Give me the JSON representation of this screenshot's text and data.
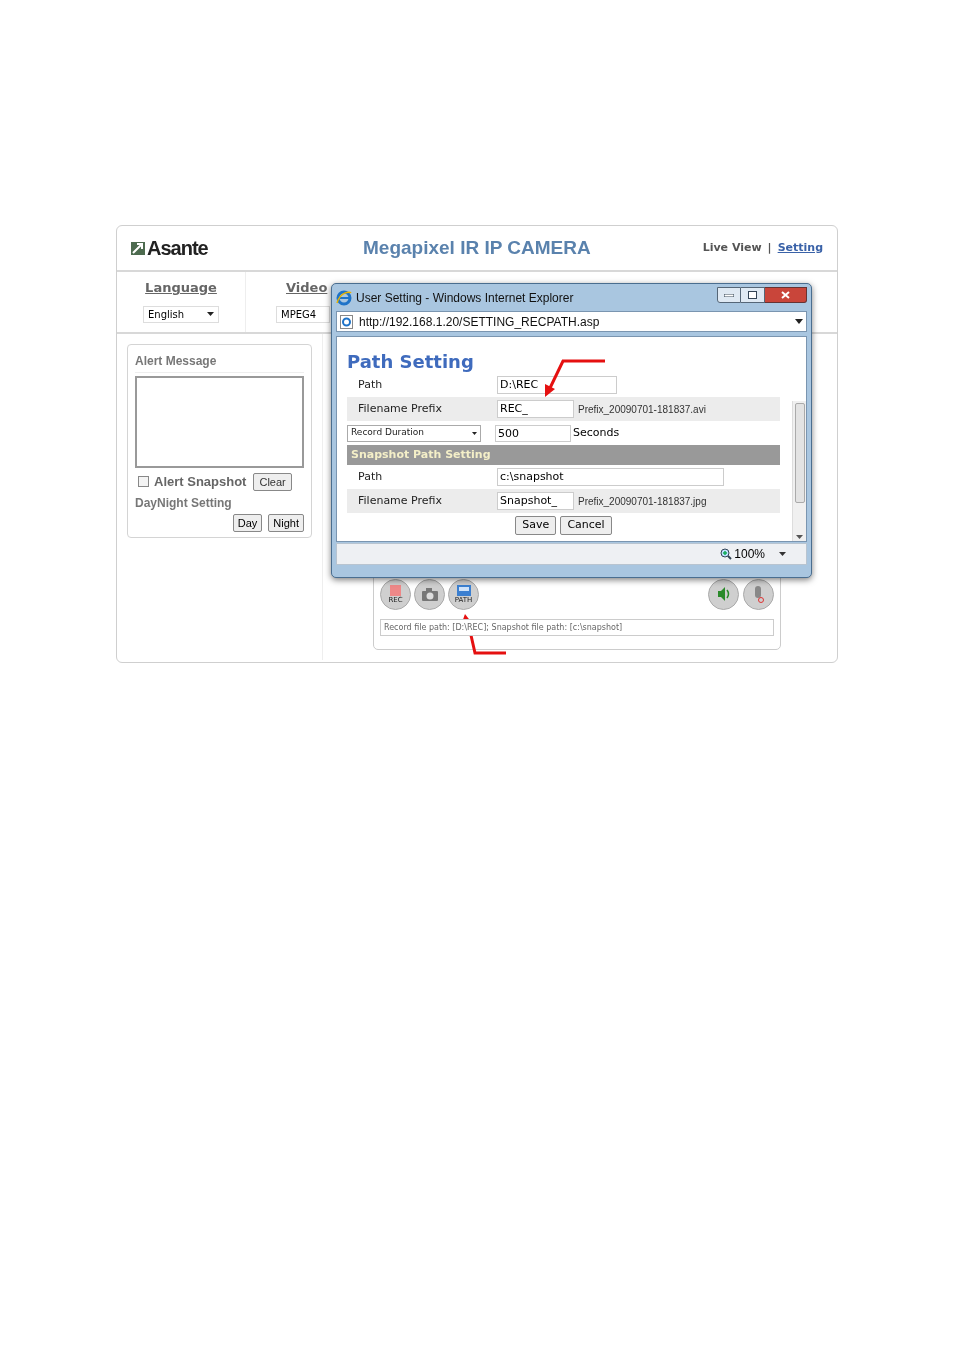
{
  "header": {
    "logo": "Asante",
    "title": "Megapixel IR IP CAMERA",
    "separator": "|",
    "links": [
      {
        "label": "Live View",
        "selected": false
      },
      {
        "label": "Setting",
        "selected": true
      }
    ]
  },
  "nav": [
    {
      "kind": "select",
      "heading": "Language",
      "value": "English"
    },
    {
      "kind": "select",
      "heading": "Video",
      "value": "MPEG4"
    }
  ],
  "alert_panel": {
    "title": "Alert Message",
    "snapshot": {
      "label": "Alert Snapshot",
      "checked": false
    },
    "clear_button": "Clear",
    "daynight_title": "DayNight Setting",
    "buttons": [
      "Day",
      "Night"
    ]
  },
  "controls": {
    "buttons": [
      {
        "kind": "rec",
        "label": "REC"
      },
      {
        "kind": "camera"
      },
      {
        "kind": "path",
        "label": "PATH"
      },
      {
        "kind": "speaker"
      },
      {
        "kind": "mic"
      }
    ],
    "status": "Record file path: [D:\\REC]; Snapshot file path: [c:\\snapshot]"
  },
  "popup": {
    "title": "User Setting - Windows Internet Explorer",
    "url": "http://192.168.1.20/SETTING_RECPATH.asp",
    "heading": "Path Setting",
    "record_rows": [
      {
        "label": "Path",
        "value": "D:\\REC"
      },
      {
        "label": "Filename Prefix",
        "value": "REC_",
        "example": "Prefix_20090701-181837.avi"
      }
    ],
    "duration": {
      "select": "Record Duration",
      "value": "500",
      "unit": "Seconds"
    },
    "snapshot_heading": "Snapshot Path Setting",
    "snapshot_rows": [
      {
        "label": "Path",
        "value": "c:\\snapshot"
      },
      {
        "label": "Filename Prefix",
        "value": "Snapshot_",
        "example": "Prefix_20090701-181837.jpg"
      }
    ],
    "buttons": [
      "Save",
      "Cancel"
    ],
    "zoom": "100%"
  }
}
